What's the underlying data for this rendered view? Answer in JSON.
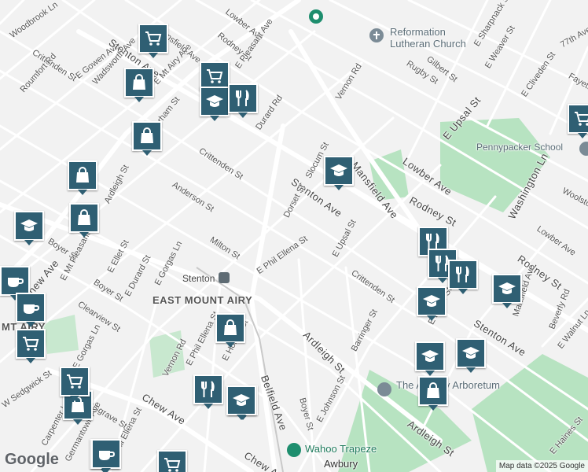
{
  "map": {
    "attribution": "Map data ©2025 Google",
    "logo": "Google",
    "colors": {
      "road": "#ffffff",
      "park": "#b7e3c1",
      "pin": "#2f5f73",
      "background": "#f2f2f2"
    }
  },
  "streets": [
    "Woodbrook Ln",
    "Crittenden St",
    "Roumfort Rd",
    "E Gowen Ave",
    "Stenton Ave",
    "Wadsworth Ave",
    "E Mt Airy Ave",
    "Mansfield Ave",
    "Rodney St",
    "Lowber Ave",
    "E Pleasant Ave",
    "Durham St",
    "Durard Rd",
    "Vernon Rd",
    "Rugby St",
    "Gilbert St",
    "E Sharpnack St",
    "E Weaver St",
    "77th Ave",
    "Fayette St",
    "E Upsal St",
    "E Cliveden St",
    "Crittenden St",
    "Slocum St",
    "Anderson St",
    "Ardleigh St",
    "Mansfield Ave",
    "Lowber Ave",
    "Washington Ln",
    "Woolston Ave",
    "Stenton Ave",
    "Dorset St",
    "Rodney St",
    "Lowber Ave",
    "Boyer St",
    "E Mt Pleasant Ave",
    "Milton St",
    "E Phil Ellena St",
    "E Upsal St",
    "Rodney St",
    "E Ellet St",
    "Boyer St",
    "E Durard St",
    "E Gorgas Ln",
    "Crittenden St",
    "Chew Ave",
    "Clearview St",
    "E Duval St",
    "Stenton Ave",
    "Mansfield Ave",
    "Beverly Rd",
    "E Walnut Ln",
    "Vernon Rd",
    "E Phil Ellena St",
    "E Hortter St",
    "Ardleigh St",
    "Barringer St",
    "Belfield Ave",
    "Musgrave St",
    "Chew Ave",
    "E Johnson St",
    "W Sedgwick St",
    "Boyer St",
    "Ardleigh St",
    "E Haines St",
    "E Gorgas Ln",
    "Carpenter Ln",
    "Chew Ave",
    "E Phil Ellena St",
    "Germantown Ave"
  ],
  "places": {
    "reformation": "Reformation Lutheran Church",
    "pennypacker": "Pennypacker School",
    "neighborhood": "EAST MOUNT AIRY",
    "stenton_station": "Stenton",
    "arboretum": "The Awbury Arboretum",
    "wahoo": "Wahoo Trapeze",
    "awbury": "Awbury",
    "mt_airy": "MT AIRY"
  },
  "pins": [
    {
      "type": "shopping-cart"
    },
    {
      "type": "shopping-bag"
    },
    {
      "type": "shopping-cart"
    },
    {
      "type": "graduation-cap"
    },
    {
      "type": "restaurant"
    },
    {
      "type": "shopping-bag"
    },
    {
      "type": "shopping-bag"
    },
    {
      "type": "graduation-cap"
    },
    {
      "type": "graduation-cap"
    },
    {
      "type": "shopping-bag"
    },
    {
      "type": "coffee"
    },
    {
      "type": "coffee"
    },
    {
      "type": "shopping-cart"
    },
    {
      "type": "shopping-bag"
    },
    {
      "type": "graduation-cap"
    },
    {
      "type": "restaurant"
    },
    {
      "type": "restaurant"
    },
    {
      "type": "restaurant"
    },
    {
      "type": "graduation-cap"
    },
    {
      "type": "graduation-cap"
    },
    {
      "type": "graduation-cap"
    },
    {
      "type": "graduation-cap"
    },
    {
      "type": "shopping-bag"
    },
    {
      "type": "shopping-bag"
    },
    {
      "type": "restaurant"
    },
    {
      "type": "graduation-cap"
    },
    {
      "type": "shopping-cart"
    },
    {
      "type": "shopping-bag"
    },
    {
      "type": "coffee"
    },
    {
      "type": "shopping-cart"
    },
    {
      "type": "shopping-cart"
    }
  ]
}
